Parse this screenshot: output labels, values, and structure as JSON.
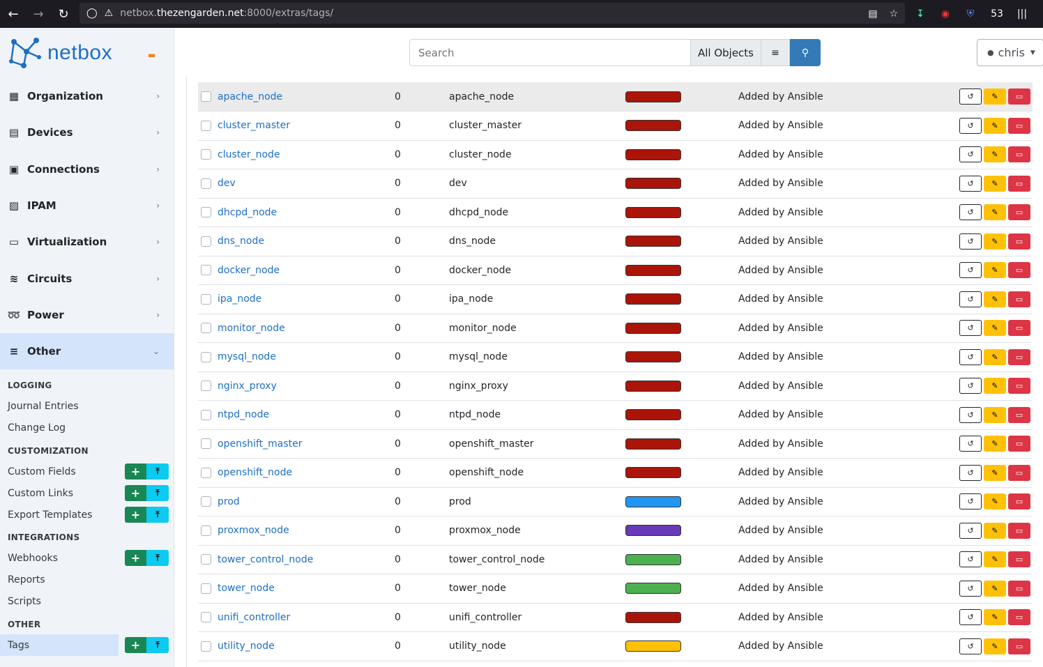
{
  "browser": {
    "url_prefix": "netbox.",
    "url_domain": "thezengarden.net",
    "url_suffix": ":8000/extras/tags/",
    "badge_count": "53"
  },
  "brand": {
    "name": "netbox"
  },
  "menu": [
    {
      "label": "Organization",
      "icon": "building-icon"
    },
    {
      "label": "Devices",
      "icon": "server-icon"
    },
    {
      "label": "Connections",
      "icon": "ethernet-icon"
    },
    {
      "label": "IPAM",
      "icon": "ipam-icon"
    },
    {
      "label": "Virtualization",
      "icon": "monitor-icon"
    },
    {
      "label": "Circuits",
      "icon": "circuit-icon"
    },
    {
      "label": "Power",
      "icon": "lightning-icon"
    },
    {
      "label": "Other",
      "icon": "notes-icon"
    }
  ],
  "submenu": {
    "logging": {
      "heading": "LOGGING",
      "items": [
        "Journal Entries",
        "Change Log"
      ]
    },
    "customization": {
      "heading": "CUSTOMIZATION",
      "items": [
        "Custom Fields",
        "Custom Links",
        "Export Templates"
      ]
    },
    "integrations": {
      "heading": "INTEGRATIONS",
      "items": [
        "Webhooks",
        "Reports",
        "Scripts"
      ]
    },
    "other": {
      "heading": "OTHER",
      "items": [
        "Tags"
      ]
    }
  },
  "header": {
    "search_placeholder": "Search",
    "search_scope": "All Objects",
    "user": "chris"
  },
  "colors": {
    "red": "#aa1409",
    "blue": "#2196f3",
    "purple": "#673ab7",
    "green": "#4caf50",
    "yellow": "#ffc107"
  },
  "tags": [
    {
      "name": "apache_node",
      "items": "0",
      "slug": "apache_node",
      "color": "#aa1409",
      "description": "Added by Ansible"
    },
    {
      "name": "cluster_master",
      "items": "0",
      "slug": "cluster_master",
      "color": "#aa1409",
      "description": "Added by Ansible"
    },
    {
      "name": "cluster_node",
      "items": "0",
      "slug": "cluster_node",
      "color": "#aa1409",
      "description": "Added by Ansible"
    },
    {
      "name": "dev",
      "items": "0",
      "slug": "dev",
      "color": "#aa1409",
      "description": "Added by Ansible"
    },
    {
      "name": "dhcpd_node",
      "items": "0",
      "slug": "dhcpd_node",
      "color": "#aa1409",
      "description": "Added by Ansible"
    },
    {
      "name": "dns_node",
      "items": "0",
      "slug": "dns_node",
      "color": "#aa1409",
      "description": "Added by Ansible"
    },
    {
      "name": "docker_node",
      "items": "0",
      "slug": "docker_node",
      "color": "#aa1409",
      "description": "Added by Ansible"
    },
    {
      "name": "ipa_node",
      "items": "0",
      "slug": "ipa_node",
      "color": "#aa1409",
      "description": "Added by Ansible"
    },
    {
      "name": "monitor_node",
      "items": "0",
      "slug": "monitor_node",
      "color": "#aa1409",
      "description": "Added by Ansible"
    },
    {
      "name": "mysql_node",
      "items": "0",
      "slug": "mysql_node",
      "color": "#aa1409",
      "description": "Added by Ansible"
    },
    {
      "name": "nginx_proxy",
      "items": "0",
      "slug": "nginx_proxy",
      "color": "#aa1409",
      "description": "Added by Ansible"
    },
    {
      "name": "ntpd_node",
      "items": "0",
      "slug": "ntpd_node",
      "color": "#aa1409",
      "description": "Added by Ansible"
    },
    {
      "name": "openshift_master",
      "items": "0",
      "slug": "openshift_master",
      "color": "#aa1409",
      "description": "Added by Ansible"
    },
    {
      "name": "openshift_node",
      "items": "0",
      "slug": "openshift_node",
      "color": "#aa1409",
      "description": "Added by Ansible"
    },
    {
      "name": "prod",
      "items": "0",
      "slug": "prod",
      "color": "#2196f3",
      "description": "Added by Ansible"
    },
    {
      "name": "proxmox_node",
      "items": "0",
      "slug": "proxmox_node",
      "color": "#673ab7",
      "description": "Added by Ansible"
    },
    {
      "name": "tower_control_node",
      "items": "0",
      "slug": "tower_control_node",
      "color": "#4caf50",
      "description": "Added by Ansible"
    },
    {
      "name": "tower_node",
      "items": "0",
      "slug": "tower_node",
      "color": "#4caf50",
      "description": "Added by Ansible"
    },
    {
      "name": "unifi_controller",
      "items": "0",
      "slug": "unifi_controller",
      "color": "#aa1409",
      "description": "Added by Ansible"
    },
    {
      "name": "utility_node",
      "items": "0",
      "slug": "utility_node",
      "color": "#ffc107",
      "description": "Added by Ansible"
    }
  ]
}
